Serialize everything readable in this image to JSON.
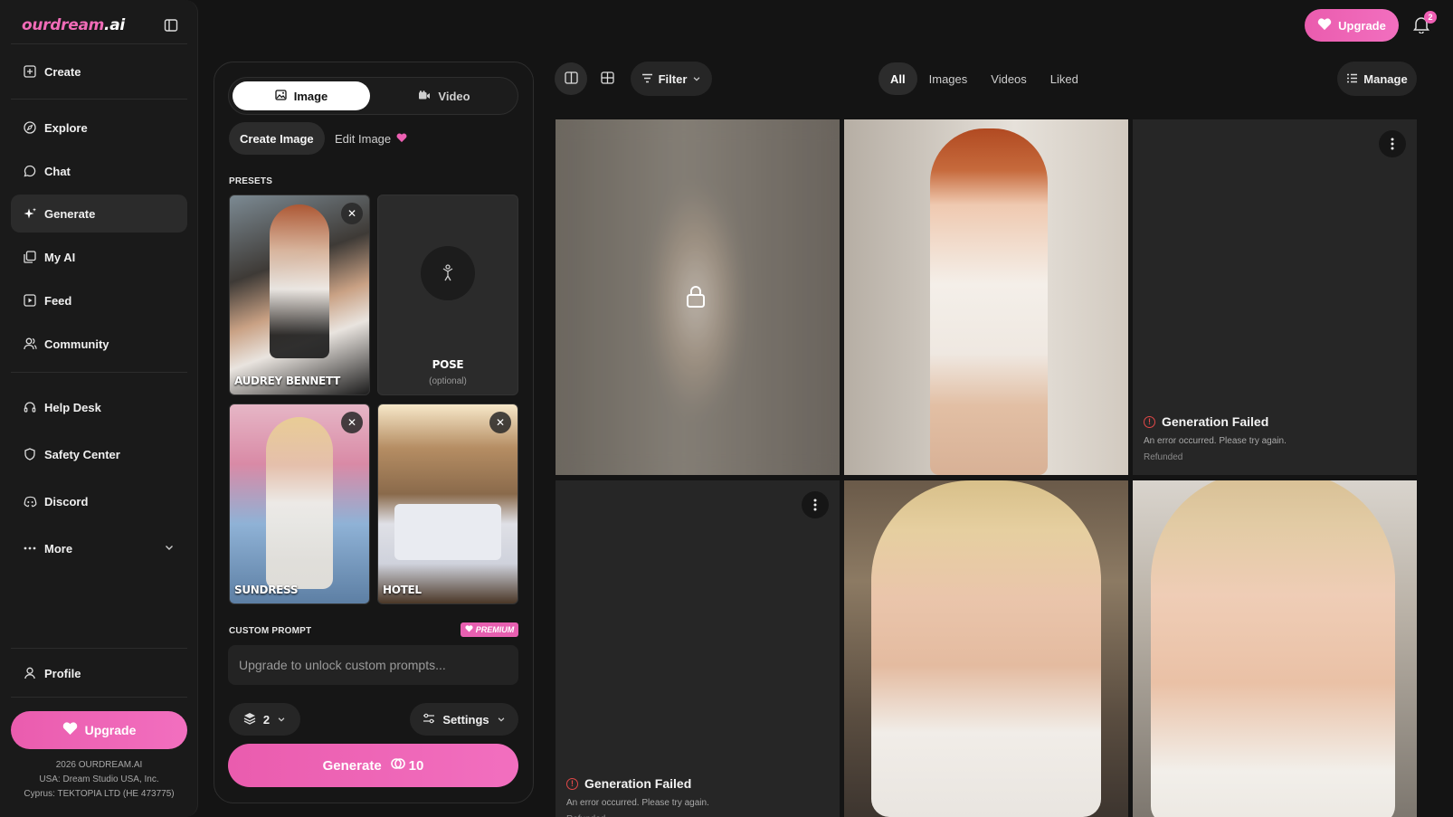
{
  "app": {
    "logo_main": "ourdream",
    "logo_tld": ".ai"
  },
  "sidebar": {
    "items": [
      {
        "label": "Create",
        "icon": "plus-square-icon"
      },
      {
        "label": "Explore",
        "icon": "compass-icon"
      },
      {
        "label": "Chat",
        "icon": "chat-bubble-icon"
      },
      {
        "label": "Generate",
        "icon": "sparkle-icon"
      },
      {
        "label": "My AI",
        "icon": "gallery-stack-icon"
      },
      {
        "label": "Feed",
        "icon": "play-square-icon"
      },
      {
        "label": "Community",
        "icon": "users-icon"
      },
      {
        "label": "Help Desk",
        "icon": "headset-icon"
      },
      {
        "label": "Safety Center",
        "icon": "shield-icon"
      },
      {
        "label": "Discord",
        "icon": "discord-icon"
      },
      {
        "label": "More",
        "icon": "ellipsis-icon"
      },
      {
        "label": "Profile",
        "icon": "user-icon"
      }
    ],
    "upgrade_label": "Upgrade",
    "footer": [
      "2026 OURDREAM.AI",
      "USA: Dream Studio USA, Inc.",
      "Cyprus: TEKTOPIA LTD (HE 473775)"
    ]
  },
  "topbar": {
    "upgrade_label": "Upgrade",
    "notification_count": "2"
  },
  "create_panel": {
    "mode_tabs": [
      "Image",
      "Video"
    ],
    "sub_tabs": [
      "Create Image",
      "Edit Image"
    ],
    "presets_label": "PRESETS",
    "presets": [
      {
        "title": "AUDREY BENNETT"
      },
      {
        "title": "POSE",
        "subtitle": "(optional)"
      },
      {
        "title": "SUNDRESS"
      },
      {
        "title": "HOTEL"
      }
    ],
    "custom_prompt_label": "CUSTOM PROMPT",
    "premium_badge": "PREMIUM",
    "prompt_placeholder": "Upgrade to unlock custom prompts...",
    "count_value": "2",
    "settings_label": "Settings",
    "generate_label": "Generate",
    "generate_cost": "10"
  },
  "gallery": {
    "filter_label": "Filter",
    "tabs": [
      "All",
      "Images",
      "Videos",
      "Liked"
    ],
    "manage_label": "Manage",
    "failed_title": "Generation Failed",
    "failed_desc": "An error occurred. Please try again.",
    "failed_status": "Refunded"
  },
  "colors": {
    "accent": "#ec60b2",
    "background": "#141414",
    "error": "#e04848"
  }
}
